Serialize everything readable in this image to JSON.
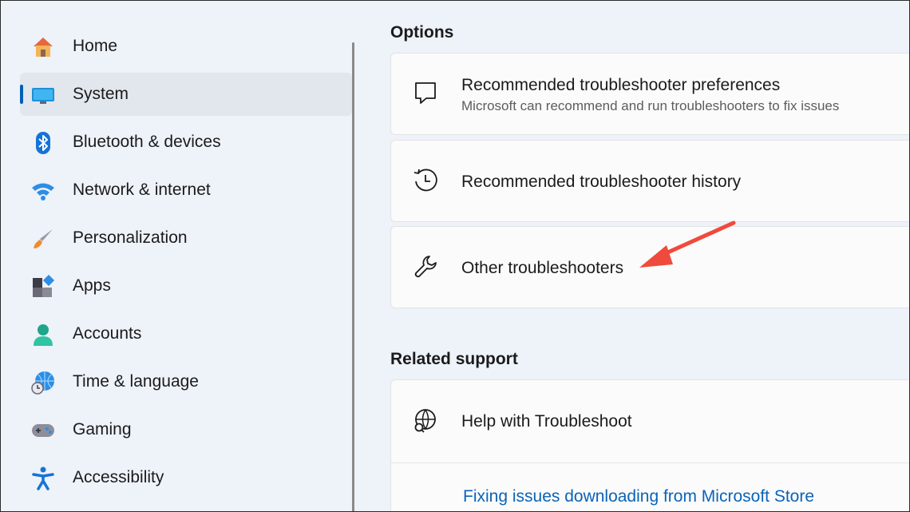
{
  "sidebar": {
    "items": [
      {
        "label": "Home",
        "icon": "home-icon",
        "selected": false
      },
      {
        "label": "System",
        "icon": "system-icon",
        "selected": true
      },
      {
        "label": "Bluetooth & devices",
        "icon": "bluetooth-icon",
        "selected": false
      },
      {
        "label": "Network & internet",
        "icon": "wifi-icon",
        "selected": false
      },
      {
        "label": "Personalization",
        "icon": "paintbrush-icon",
        "selected": false
      },
      {
        "label": "Apps",
        "icon": "apps-icon",
        "selected": false
      },
      {
        "label": "Accounts",
        "icon": "account-icon",
        "selected": false
      },
      {
        "label": "Time & language",
        "icon": "globe-clock-icon",
        "selected": false
      },
      {
        "label": "Gaming",
        "icon": "gamepad-icon",
        "selected": false
      },
      {
        "label": "Accessibility",
        "icon": "accessibility-icon",
        "selected": false
      }
    ]
  },
  "main": {
    "options_title": "Options",
    "options": [
      {
        "title": "Recommended troubleshooter preferences",
        "subtitle": "Microsoft can recommend and run troubleshooters to fix issues",
        "icon": "chat-bubble-icon"
      },
      {
        "title": "Recommended troubleshooter history",
        "icon": "history-icon"
      },
      {
        "title": "Other troubleshooters",
        "icon": "wrench-icon"
      }
    ],
    "related_title": "Related support",
    "related": {
      "title": "Help with Troubleshoot",
      "icon": "globe-search-icon",
      "link": "Fixing issues downloading from Microsoft Store"
    }
  },
  "colors": {
    "accent": "#005fb8",
    "link": "#0a63b8",
    "annotation_arrow": "#f04a3c"
  }
}
